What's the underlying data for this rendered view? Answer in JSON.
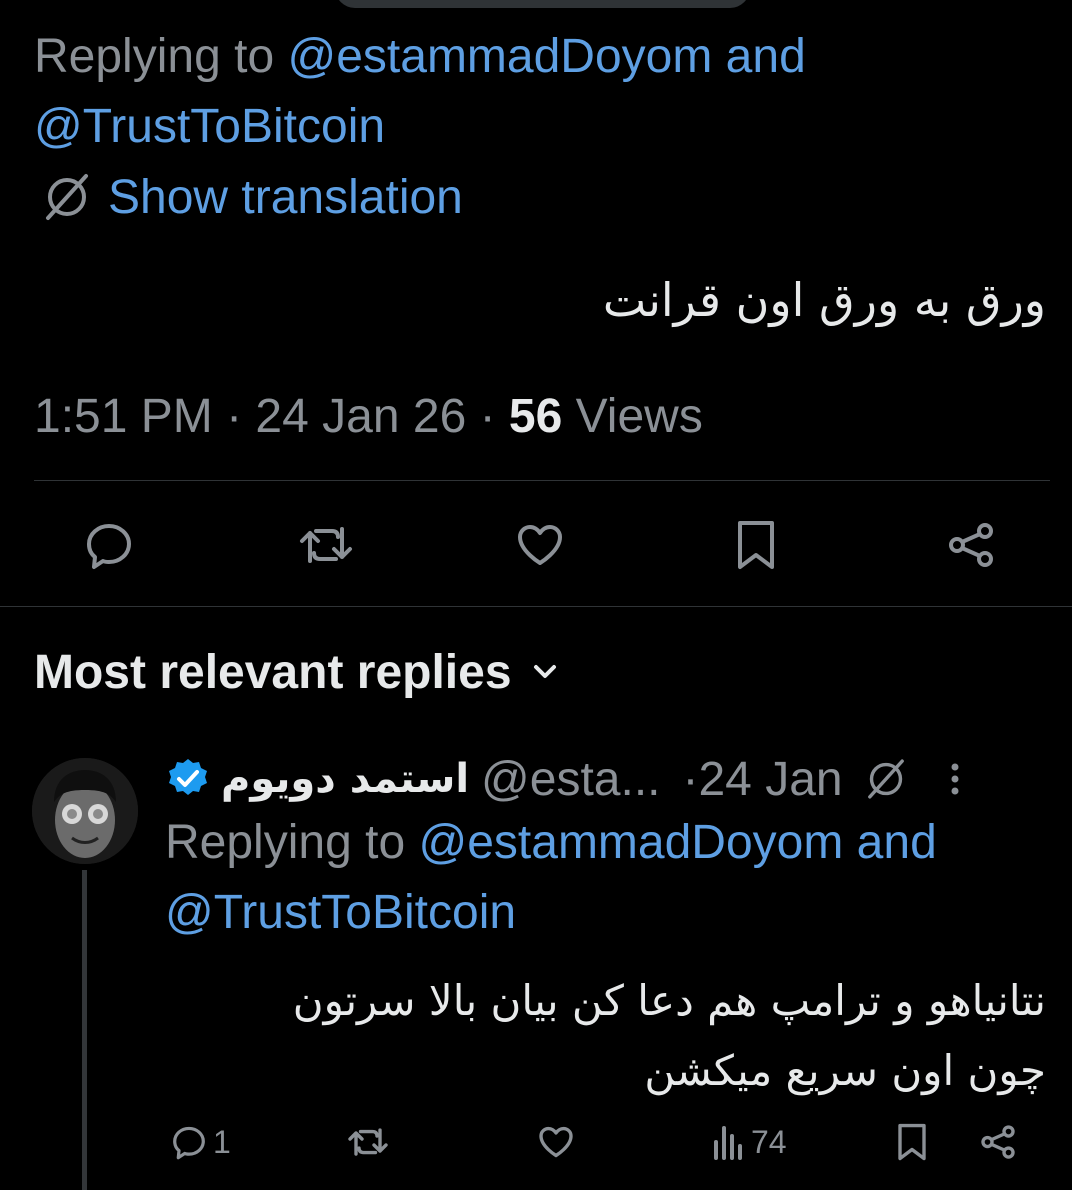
{
  "main_tweet": {
    "replying_prefix": "Replying to ",
    "replying_user_1": "@estammadDoyom",
    "and_text": " and",
    "replying_user_2": "@TrustToBitcoin",
    "show_translation": "Show translation",
    "text": "ورق به ورق اون قرانت",
    "time": "1:51 PM",
    "sep1": " · ",
    "date": "24 Jan 26",
    "sep2": " · ",
    "views_count": "56",
    "views_label": " Views"
  },
  "section": {
    "title": "Most relevant replies"
  },
  "reply": {
    "display_name": "استمد دویوم",
    "handle": "@esta...",
    "sep": " · ",
    "date": "24 Jan",
    "replying_prefix": "Replying to ",
    "replying_user_1": "@estammadDoyom",
    "and_text": " and",
    "replying_user_2": "@TrustToBitcoin",
    "text_line1": "نتانیاهو و ترامپ هم دعا کن بیان بالا سرتون",
    "text_line2": "چون اون سریع میکشن",
    "reply_count": "1",
    "views_count": "74"
  },
  "colors": {
    "background": "#000000",
    "text": "#e7e9ea",
    "muted": "#8b9096",
    "link": "#5e9fe3",
    "verified": "#1d9bf0"
  },
  "icons": [
    "translate-icon",
    "reply-icon",
    "retweet-icon",
    "like-icon",
    "bookmark-icon",
    "share-icon",
    "chevron-down-icon",
    "verified-badge-icon",
    "more-icon",
    "views-icon"
  ]
}
